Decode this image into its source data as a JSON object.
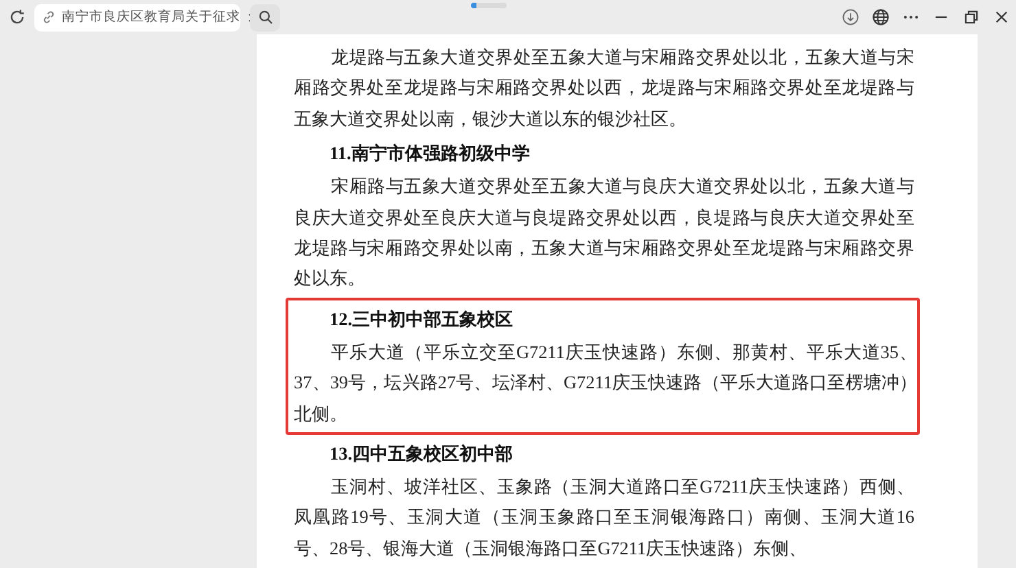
{
  "browser": {
    "tab": {
      "title": "南宁市良庆区教育局关于征求"
    }
  },
  "document": {
    "sections": [
      {
        "highlighted": false,
        "paragraph": "龙堤路与五象大道交界处至五象大道与宋厢路交界处以北，五象大道与宋厢路交界处至龙堤路与宋厢路交界处以西，龙堤路与宋厢路交界处至龙堤路与五象大道交界处以南，银沙大道以东的银沙社区。"
      },
      {
        "heading": "11.南宁市体强路初级中学",
        "highlighted": false,
        "paragraph": "宋厢路与五象大道交界处至五象大道与良庆大道交界处以北，五象大道与良庆大道交界处至良庆大道与良堤路交界处以西，良堤路与良庆大道交界处至龙堤路与宋厢路交界处以南，五象大道与宋厢路交界处至龙堤路与宋厢路交界处以东。"
      },
      {
        "heading": "12.三中初中部五象校区",
        "highlighted": true,
        "paragraph": "平乐大道（平乐立交至G7211庆玉快速路）东侧、那黄村、平乐大道35、37、39号，坛兴路27号、坛泽村、G7211庆玉快速路（平乐大道路口至楞塘冲）北侧。"
      },
      {
        "heading": "13.四中五象校区初中部",
        "highlighted": false,
        "paragraph": "玉洞村、坡洋社区、玉象路（玉洞大道路口至G7211庆玉快速路）西侧、凤凰路19号、玉洞大道（玉洞玉象路口至玉洞银海路口）南侧、玉洞大道16号、28号、银海大道（玉洞银海路口至G7211庆玉快速路）东侧、"
      }
    ]
  }
}
